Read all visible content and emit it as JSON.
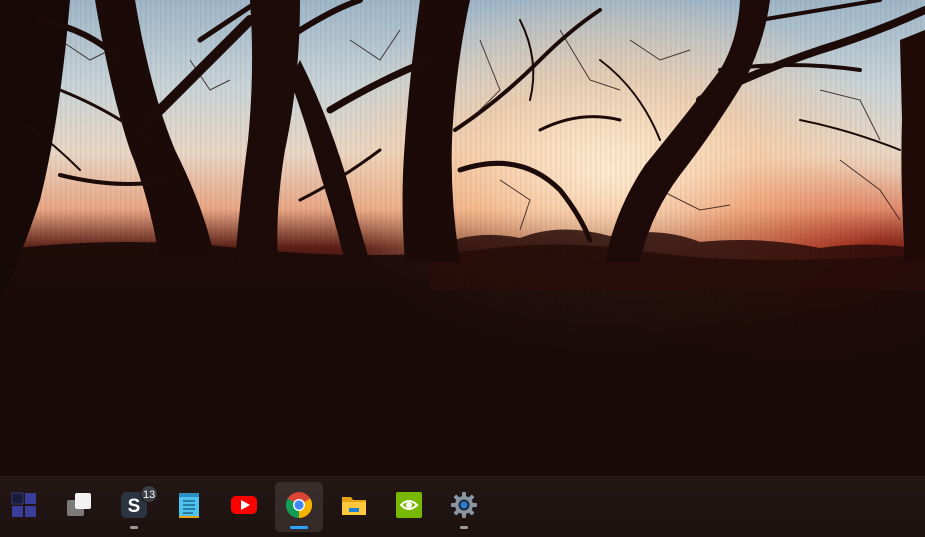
{
  "wallpaper": {
    "description_icon": "sunset-forest-wallpaper"
  },
  "taskbar": {
    "apps": [
      {
        "name": "start-button",
        "icon": "windows-start-icon",
        "running": false,
        "active": false
      },
      {
        "name": "task-view-button",
        "icon": "task-view-icon",
        "running": false,
        "active": false
      },
      {
        "name": "app-s-button",
        "icon": "s-app-icon",
        "running": true,
        "active": false,
        "badge": "13"
      },
      {
        "name": "notepad-button",
        "icon": "notepad-icon",
        "running": false,
        "active": false
      },
      {
        "name": "youtube-button",
        "icon": "youtube-icon",
        "running": false,
        "active": false
      },
      {
        "name": "chrome-button",
        "icon": "chrome-icon",
        "running": true,
        "active": true
      },
      {
        "name": "file-explorer-button",
        "icon": "folder-icon",
        "running": false,
        "active": false
      },
      {
        "name": "nvidia-button",
        "icon": "nvidia-icon",
        "running": false,
        "active": false
      },
      {
        "name": "settings-button",
        "icon": "gear-icon",
        "running": true,
        "active": false
      }
    ],
    "colors": {
      "active_indicator": "#29a5ff",
      "running_indicator": "#9a9a9a",
      "background": "#1c1210"
    }
  }
}
